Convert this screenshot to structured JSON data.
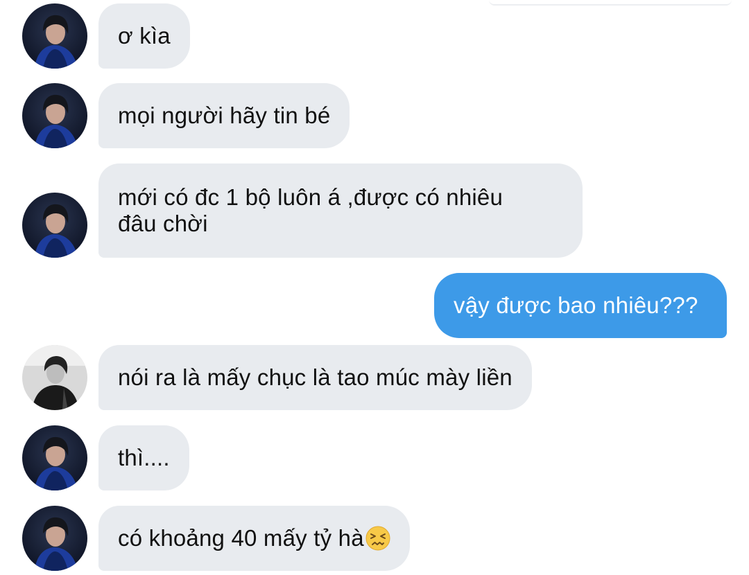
{
  "messages": [
    {
      "sender": "them",
      "text": "ơ kìa"
    },
    {
      "sender": "them",
      "text": "mọi người hãy tin bé"
    },
    {
      "sender": "them",
      "lines": [
        "mới có đc 1 bộ luôn á ,được có nhiêu",
        "đâu chời"
      ]
    },
    {
      "sender": "me",
      "text": "vậy được bao nhiêu???"
    },
    {
      "sender": "them",
      "text": "nói ra là mấy chục là tao múc mày liền"
    },
    {
      "sender": "them",
      "text": "thì...."
    },
    {
      "sender": "them",
      "text": "có khoảng 40 mấy tỷ hà",
      "emoji": "confounded-face-icon"
    }
  ],
  "colors": {
    "incoming_bubble": "#e8ebef",
    "outgoing_bubble": "#3d9ae8",
    "incoming_text": "#111111",
    "outgoing_text": "#ffffff"
  }
}
